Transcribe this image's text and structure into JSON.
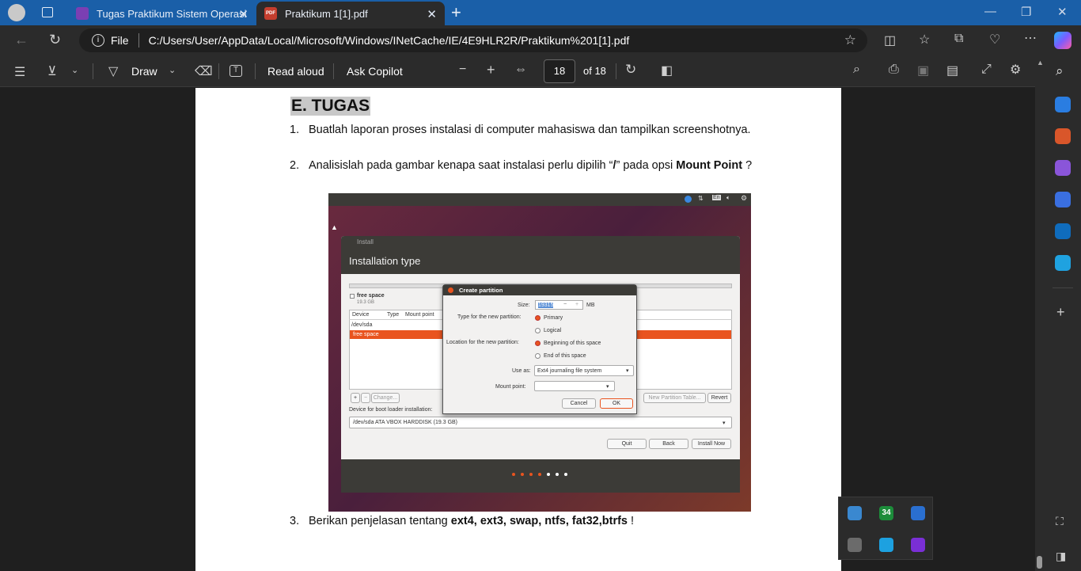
{
  "browser": {
    "tabs": [
      {
        "title": "Tugas Praktikum Sistem Operasi"
      },
      {
        "title": "Praktikum 1[1].pdf",
        "badge": "PDF"
      }
    ],
    "address": {
      "scheme_label": "File",
      "url": "C:/Users/User/AppData/Local/Microsoft/Windows/INetCache/IE/4E9HLR2R/Praktikum%201[1].pdf"
    }
  },
  "pdf_toolbar": {
    "draw_label": "Draw",
    "read_aloud_label": "Read aloud",
    "ask_copilot_label": "Ask Copilot",
    "page_current": "18",
    "page_total": "of 18"
  },
  "document": {
    "heading": "E. TUGAS",
    "items": [
      {
        "number": "1.",
        "text": "Buatlah laporan proses instalasi di computer mahasiswa dan tampilkan screenshotnya."
      },
      {
        "number": "2.",
        "text_before": "Analisislah pada gambar kenapa saat instalasi perlu dipilih “",
        "bold1": "/",
        "text_mid": "” pada opsi ",
        "bold2": "Mount Point",
        "text_after": " ?"
      },
      {
        "number": "3.",
        "text_before": "Berikan penjelasan tentang ",
        "bold": "ext4, ext3, swap, ntfs, fat32,btrfs",
        "text_after": " !"
      }
    ]
  },
  "installer": {
    "window_title": "Install",
    "header": "Installation type",
    "free_space_label": "free space",
    "free_space_size": "19.3 GB",
    "columns": [
      "Device",
      "Type",
      "Mount point"
    ],
    "rows": [
      "/dev/sda",
      "free space"
    ],
    "plus": "+",
    "minus": "−",
    "change_label": "Change...",
    "new_table_label": "New Partition Table...",
    "revert_label": "Revert",
    "bootloader_label": "Device for boot loader installation:",
    "bootloader_value": "/dev/sda  ATA VBOX HARDDISK (19.3 GB)",
    "quit_label": "Quit",
    "back_label": "Back",
    "install_now_label": "Install Now",
    "topbar_lang": "En",
    "dialog": {
      "title": "Create partition",
      "size_label": "Size:",
      "size_value": "19315",
      "size_unit": "MB",
      "type_label": "Type for the new partition:",
      "type_primary": "Primary",
      "type_logical": "Logical",
      "location_label": "Location for the new partition:",
      "loc_begin": "Beginning of this space",
      "loc_end": "End of this space",
      "use_as_label": "Use as:",
      "use_as_value": "Ext4 journaling file system",
      "mount_label": "Mount point:",
      "cancel_label": "Cancel",
      "ok_label": "OK"
    }
  },
  "tray": {
    "badge_number": "34"
  },
  "colors": {
    "titlebar": "#1a5fa8",
    "chrome": "#2b2b2b",
    "ubuntu_orange": "#e9541f"
  }
}
